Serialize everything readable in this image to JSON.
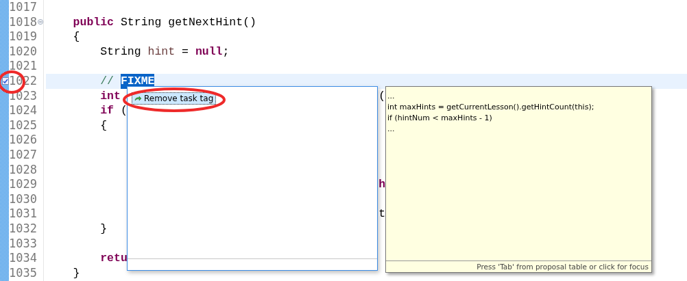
{
  "editor": {
    "lines": [
      {
        "number": "1017",
        "current": false,
        "foldable": false,
        "task_marker": false
      },
      {
        "number": "1018",
        "current": false,
        "foldable": true,
        "task_marker": false,
        "tokens": [
          {
            "text": "    public",
            "kind": "keyword"
          },
          {
            "text": " String getNextHint()",
            "kind": "plain"
          }
        ]
      },
      {
        "number": "1019",
        "current": false,
        "foldable": false,
        "task_marker": false,
        "tokens": [
          {
            "text": "    {",
            "kind": "plain"
          }
        ]
      },
      {
        "number": "1020",
        "current": false,
        "foldable": false,
        "task_marker": false,
        "tokens": [
          {
            "text": "        String",
            "kind": "plain"
          },
          {
            "text": " hint",
            "kind": "variable"
          },
          {
            "text": " =",
            "kind": "plain"
          },
          {
            "text": " null",
            "kind": "keyword"
          },
          {
            "text": ";",
            "kind": "plain"
          }
        ]
      },
      {
        "number": "1021",
        "current": false,
        "foldable": false,
        "task_marker": false
      },
      {
        "number": "1022",
        "current": true,
        "foldable": false,
        "task_marker": true,
        "tokens": [
          {
            "text": "        //",
            "kind": "comment"
          },
          {
            "text": " FIXME",
            "kind": "selection"
          }
        ]
      },
      {
        "number": "1023",
        "current": false,
        "foldable": false,
        "task_marker": false,
        "tokens": [
          {
            "text": "        int",
            "kind": "keyword"
          },
          {
            "text": "                                      (",
            "kind": "plain"
          }
        ]
      },
      {
        "number": "1024",
        "current": false,
        "foldable": false,
        "task_marker": false,
        "tokens": [
          {
            "text": "        if",
            "kind": "keyword"
          },
          {
            "text": " (",
            "kind": "plain"
          }
        ]
      },
      {
        "number": "1025",
        "current": false,
        "foldable": false,
        "task_marker": false,
        "tokens": [
          {
            "text": "        {",
            "kind": "plain"
          }
        ]
      },
      {
        "number": "1026",
        "current": false,
        "foldable": false,
        "task_marker": false
      },
      {
        "number": "1027",
        "current": false,
        "foldable": false,
        "task_marker": false
      },
      {
        "number": "1028",
        "current": false,
        "foldable": false,
        "task_marker": false
      },
      {
        "number": "1029",
        "current": false,
        "foldable": false,
        "task_marker": false,
        "tokens": [
          {
            "text": "                                                 h",
            "kind": "keyword"
          }
        ]
      },
      {
        "number": "1030",
        "current": false,
        "foldable": false,
        "task_marker": false
      },
      {
        "number": "1031",
        "current": false,
        "foldable": false,
        "task_marker": false,
        "tokens": [
          {
            "text": "                                                 t",
            "kind": "plain"
          }
        ]
      },
      {
        "number": "1032",
        "current": false,
        "foldable": false,
        "task_marker": false,
        "tokens": [
          {
            "text": "        }",
            "kind": "plain"
          }
        ]
      },
      {
        "number": "1033",
        "current": false,
        "foldable": false,
        "task_marker": false
      },
      {
        "number": "1034",
        "current": false,
        "foldable": false,
        "task_marker": false,
        "tokens": [
          {
            "text": "        retu",
            "kind": "keyword"
          }
        ]
      },
      {
        "number": "1035",
        "current": false,
        "foldable": false,
        "task_marker": false,
        "tokens": [
          {
            "text": "    }",
            "kind": "plain"
          }
        ]
      }
    ]
  },
  "proposals": [
    {
      "label": "Remove task tag",
      "selected": true
    }
  ],
  "info": {
    "lines": [
      "...",
      "int maxHints = getCurrentLesson().getHintCount(this);",
      "if (hintNum < maxHints - 1)",
      "..."
    ],
    "footer": "Press 'Tab' from proposal table or click for focus"
  }
}
